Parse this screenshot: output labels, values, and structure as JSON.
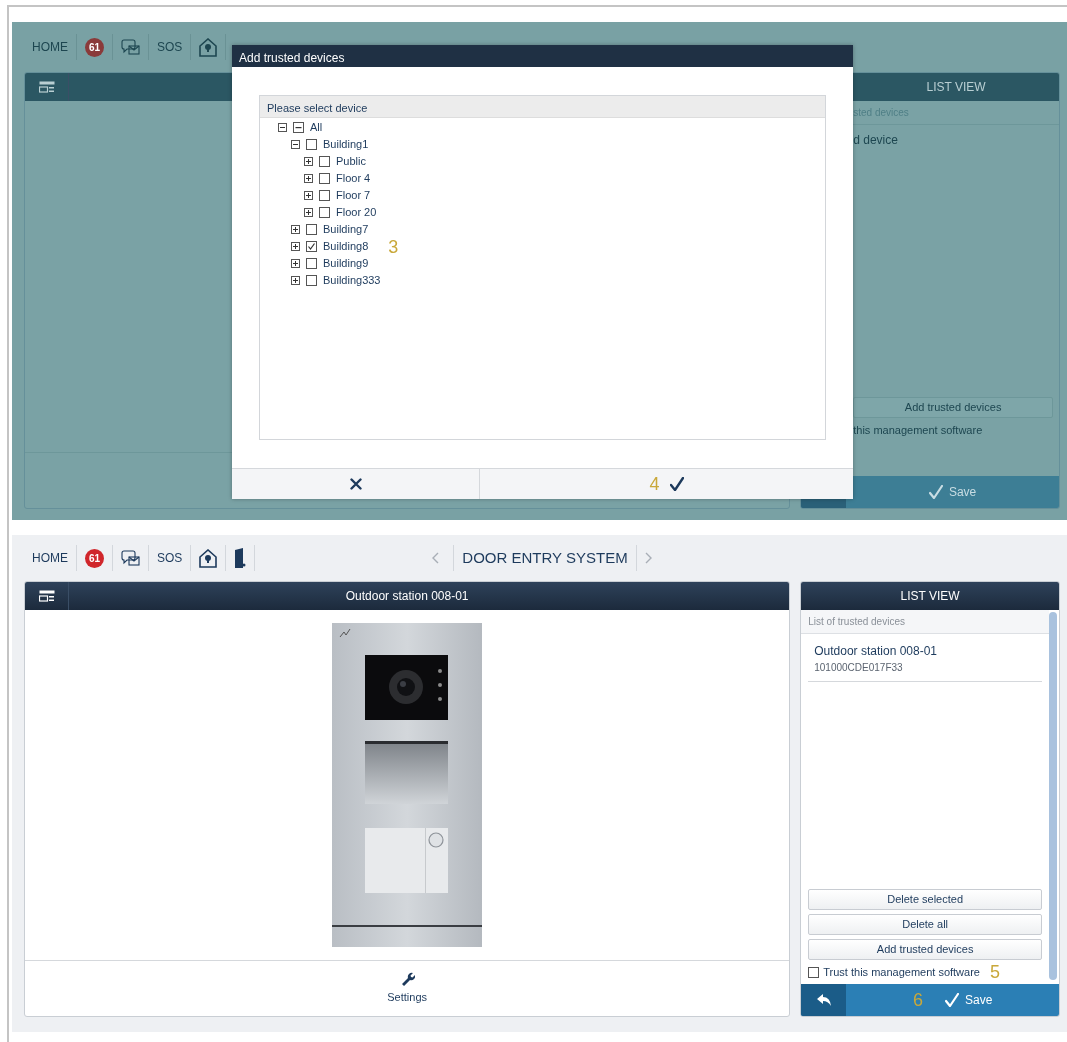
{
  "background_screen": {
    "header": {
      "home": "HOME",
      "badge": "61",
      "sos": "SOS"
    },
    "list_view": {
      "title": "LIST VIEW",
      "subtitle": "sted devices",
      "item": "d device",
      "add_button": "Add trusted devices",
      "trust_label": "this management software",
      "save": "Save"
    }
  },
  "dialog": {
    "title": "Add trusted devices",
    "tree_header": "Please select device",
    "confirm_callout": "4",
    "tree": [
      {
        "label": "All",
        "expanded": true,
        "checked": false,
        "partial": true,
        "children": [
          {
            "label": "Building1",
            "expanded": true,
            "checked": false,
            "partial": false,
            "children": [
              {
                "label": "Public",
                "expanded": false,
                "checked": false,
                "partial": false
              },
              {
                "label": "Floor 4",
                "expanded": false,
                "checked": false,
                "partial": false
              },
              {
                "label": "Floor 7",
                "expanded": false,
                "checked": false,
                "partial": false
              },
              {
                "label": "Floor 20",
                "expanded": false,
                "checked": false,
                "partial": false
              }
            ]
          },
          {
            "label": "Building7",
            "expanded": false,
            "checked": false,
            "partial": false
          },
          {
            "label": "Building8",
            "expanded": false,
            "checked": true,
            "partial": false,
            "callout": "3"
          },
          {
            "label": "Building9",
            "expanded": false,
            "checked": false,
            "partial": false
          },
          {
            "label": "Building333",
            "expanded": false,
            "checked": false,
            "partial": false
          }
        ]
      }
    ]
  },
  "screen": {
    "header": {
      "home": "HOME",
      "badge": "61",
      "sos": "SOS",
      "title": "DOOR ENTRY SYSTEM"
    },
    "main": {
      "title": "Outdoor station 008-01",
      "settings": "Settings"
    },
    "list_view": {
      "title": "LIST VIEW",
      "subtitle": "List of trusted devices",
      "devices": [
        {
          "name": "Outdoor station 008-01",
          "id": "101000CDE017F33"
        }
      ],
      "buttons": [
        "Delete selected",
        "Delete all",
        "Add trusted devices"
      ],
      "trust": {
        "label": "Trust this management software",
        "checked": false,
        "callout": "5"
      },
      "save": "Save",
      "save_callout": "6"
    }
  }
}
